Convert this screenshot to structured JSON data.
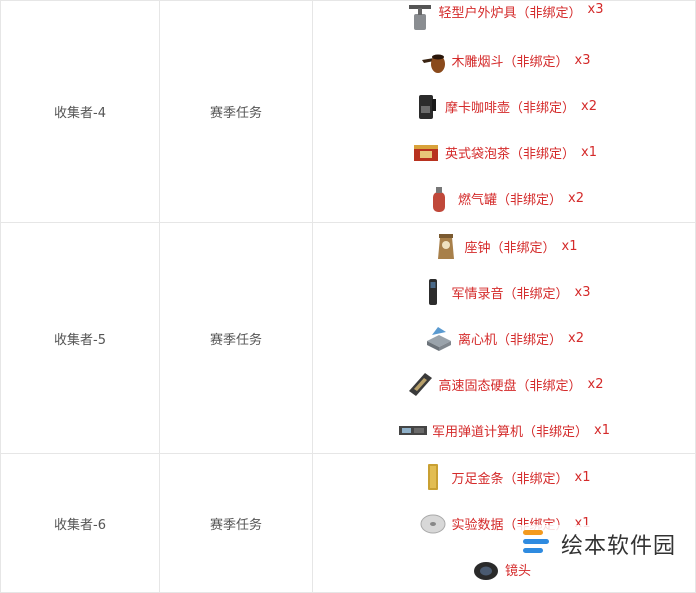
{
  "rows": [
    {
      "name": "收集者-4",
      "type": "赛季任务",
      "items": [
        {
          "icon": "camping-stove-icon",
          "label": "轻型户外炉具（非绑定）",
          "qty": "x3"
        },
        {
          "icon": "pipe-icon",
          "label": "木雕烟斗（非绑定）",
          "qty": "x3"
        },
        {
          "icon": "coffee-pot-icon",
          "label": "摩卡咖啡壶（非绑定）",
          "qty": "x2"
        },
        {
          "icon": "tea-box-icon",
          "label": "英式袋泡茶（非绑定）",
          "qty": "x1"
        },
        {
          "icon": "gas-canister-icon",
          "label": "燃气罐（非绑定）",
          "qty": "x2"
        }
      ]
    },
    {
      "name": "收集者-5",
      "type": "赛季任务",
      "items": [
        {
          "icon": "mantel-clock-icon",
          "label": "座钟（非绑定）",
          "qty": "x1"
        },
        {
          "icon": "voice-recorder-icon",
          "label": "军情录音（非绑定）",
          "qty": "x3"
        },
        {
          "icon": "centrifuge-icon",
          "label": "离心机（非绑定）",
          "qty": "x2"
        },
        {
          "icon": "ssd-icon",
          "label": "高速固态硬盘（非绑定）",
          "qty": "x2"
        },
        {
          "icon": "ballistic-computer-icon",
          "label": "军用弹道计算机（非绑定）",
          "qty": "x1"
        }
      ]
    },
    {
      "name": "收集者-6",
      "type": "赛季任务",
      "items": [
        {
          "icon": "gold-bar-icon",
          "label": "万足金条（非绑定）",
          "qty": "x1"
        },
        {
          "icon": "data-disc-icon",
          "label": "实验数据（非绑定）",
          "qty": "x1"
        },
        {
          "icon": "lens-icon",
          "label": "镜头",
          "qty": ""
        }
      ]
    }
  ],
  "watermark": {
    "text": "绘本软件园",
    "icon": "logo-icon"
  }
}
